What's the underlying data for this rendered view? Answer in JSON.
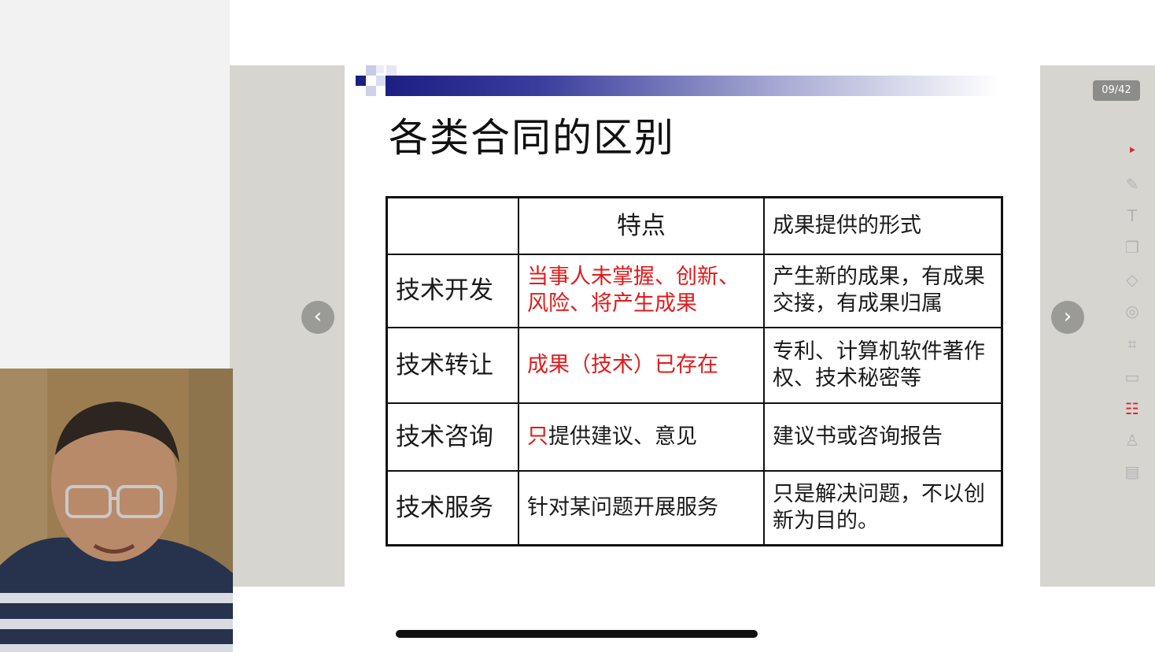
{
  "slide": {
    "title": "各类合同的区别",
    "table": {
      "header": [
        "",
        "特点",
        "成果提供的形式"
      ],
      "rows": [
        {
          "type": "技术开发",
          "feature_red": "当事人未掌握、创新、风险、将产生成果",
          "feature_black": "",
          "form": "产生新的成果，有成果交接，有成果归属"
        },
        {
          "type": "技术转让",
          "feature_red": "成果（技术）已存在",
          "feature_black": "",
          "form": "专利、计算机软件著作权、技术秘密等"
        },
        {
          "type": "技术咨询",
          "feature_red": "只",
          "feature_black": "提供建议、意见",
          "form": "建议书或咨询报告"
        },
        {
          "type": "技术服务",
          "feature_red": "",
          "feature_black": "针对某问题开展服务",
          "form": "只是解决问题，不以创新为目的。"
        }
      ]
    }
  },
  "page_counter": "09/42",
  "nav": {
    "prev_icon": "chevron-left-icon",
    "next_icon": "chevron-right-icon"
  },
  "toolbar": [
    {
      "name": "pointer-tool",
      "icon": "‣",
      "active": true
    },
    {
      "name": "pen-tool",
      "icon": "✎",
      "active": false
    },
    {
      "name": "text-tool",
      "icon": "T",
      "active": false
    },
    {
      "name": "shape-tool",
      "icon": "❐",
      "active": false
    },
    {
      "name": "eraser-tool",
      "icon": "◇",
      "active": false
    },
    {
      "name": "spotlight-tool",
      "icon": "◎",
      "active": false
    },
    {
      "name": "crop-tool",
      "icon": "⌗",
      "active": false
    },
    {
      "name": "toolbox-tool",
      "icon": "▭",
      "active": false
    },
    {
      "name": "chat-tool",
      "icon": "☷",
      "active": true
    },
    {
      "name": "participants-tool",
      "icon": "♙",
      "active": false
    },
    {
      "name": "folder-tool",
      "icon": "▤",
      "active": false
    }
  ],
  "colors": {
    "accent_red": "#e01b1b",
    "title_bar_dark": "#1c1f82",
    "stage_gray": "#d6d5d0"
  }
}
